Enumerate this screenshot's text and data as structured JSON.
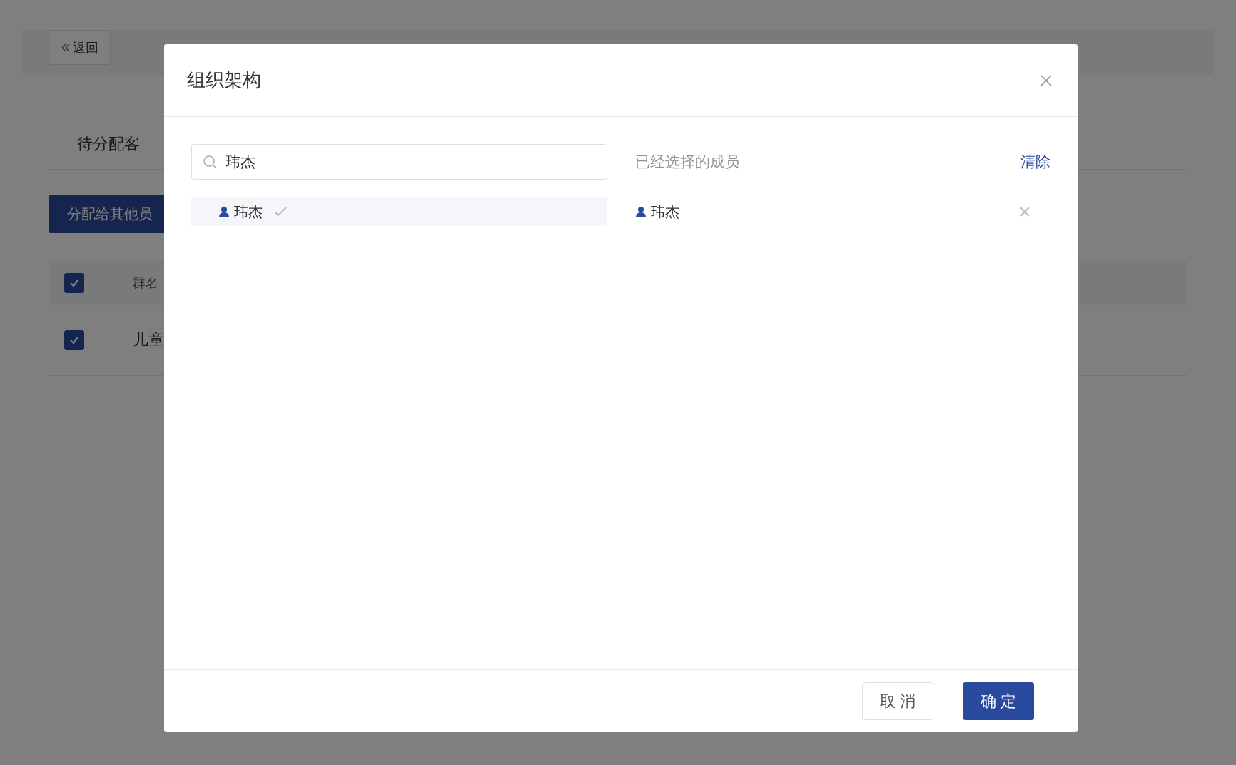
{
  "page": {
    "back_button": "返回",
    "tab": "待分配客",
    "assign_button": "分配给其他员",
    "table": {
      "header_checked": true,
      "columns": [
        "群名"
      ],
      "rows": [
        {
          "checked": true,
          "cells": [
            "儿童"
          ]
        }
      ]
    }
  },
  "dialog": {
    "title": "组织架构",
    "search": {
      "value": "玮杰"
    },
    "results": [
      {
        "name": "玮杰",
        "selected": true
      }
    ],
    "selected_heading": "已经选择的成员",
    "clear_link": "清除",
    "selected_members": [
      {
        "name": "玮杰"
      }
    ],
    "buttons": [
      {
        "label": "取 消",
        "kind": "secondary"
      },
      {
        "label": "确 定",
        "kind": "primary"
      }
    ]
  }
}
